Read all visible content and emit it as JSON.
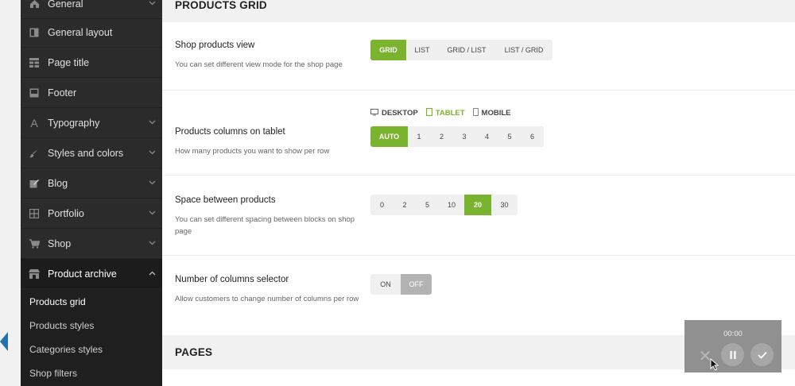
{
  "sidebar": {
    "items": [
      {
        "label": "General",
        "icon": "home-icon",
        "has_chevron": true
      },
      {
        "label": "General layout",
        "icon": "layout-icon",
        "has_chevron": false
      },
      {
        "label": "Page title",
        "icon": "grid-icon",
        "has_chevron": false
      },
      {
        "label": "Footer",
        "icon": "footer-icon",
        "has_chevron": false
      },
      {
        "label": "Typography",
        "icon": "font-icon",
        "has_chevron": true
      },
      {
        "label": "Styles and colors",
        "icon": "brush-icon",
        "has_chevron": true
      },
      {
        "label": "Blog",
        "icon": "edit-icon",
        "has_chevron": true
      },
      {
        "label": "Portfolio",
        "icon": "portfolio-icon",
        "has_chevron": true
      },
      {
        "label": "Shop",
        "icon": "cart-icon",
        "has_chevron": true
      },
      {
        "label": "Product archive",
        "icon": "store-icon",
        "has_chevron": true
      }
    ],
    "sub_items": [
      {
        "label": "Products grid",
        "current": true
      },
      {
        "label": "Products styles",
        "current": false
      },
      {
        "label": "Categories styles",
        "current": false
      },
      {
        "label": "Shop filters",
        "current": false
      }
    ]
  },
  "main": {
    "section_title": "PRODUCTS GRID",
    "options": {
      "shop_view": {
        "title": "Shop products view",
        "desc": "You can set different view mode for the shop page",
        "buttons": [
          "GRID",
          "LIST",
          "GRID / LIST",
          "LIST / GRID"
        ],
        "selected": "GRID"
      },
      "columns_tablet": {
        "devices": [
          "DESKTOP",
          "TABLET",
          "MOBILE"
        ],
        "active_device": "TABLET",
        "title": "Products columns on tablet",
        "desc": "How many products you want to show per row",
        "buttons": [
          "AUTO",
          "1",
          "2",
          "3",
          "4",
          "5",
          "6"
        ],
        "selected": "AUTO"
      },
      "spacing": {
        "title": "Space between products",
        "desc": "You can set different spacing between blocks on shop page",
        "buttons": [
          "0",
          "2",
          "5",
          "10",
          "20",
          "30"
        ],
        "selected": "20"
      },
      "columns_selector": {
        "title": "Number of columns selector",
        "desc": "Allow customers to change number of columns per row",
        "buttons": [
          "ON",
          "OFF"
        ],
        "selected": "OFF"
      }
    },
    "next_section_title": "PAGES"
  },
  "recorder": {
    "time": "00:00"
  },
  "colors": {
    "accent": "#7ab32e",
    "sidebar_bg": "#2b2b2b"
  }
}
